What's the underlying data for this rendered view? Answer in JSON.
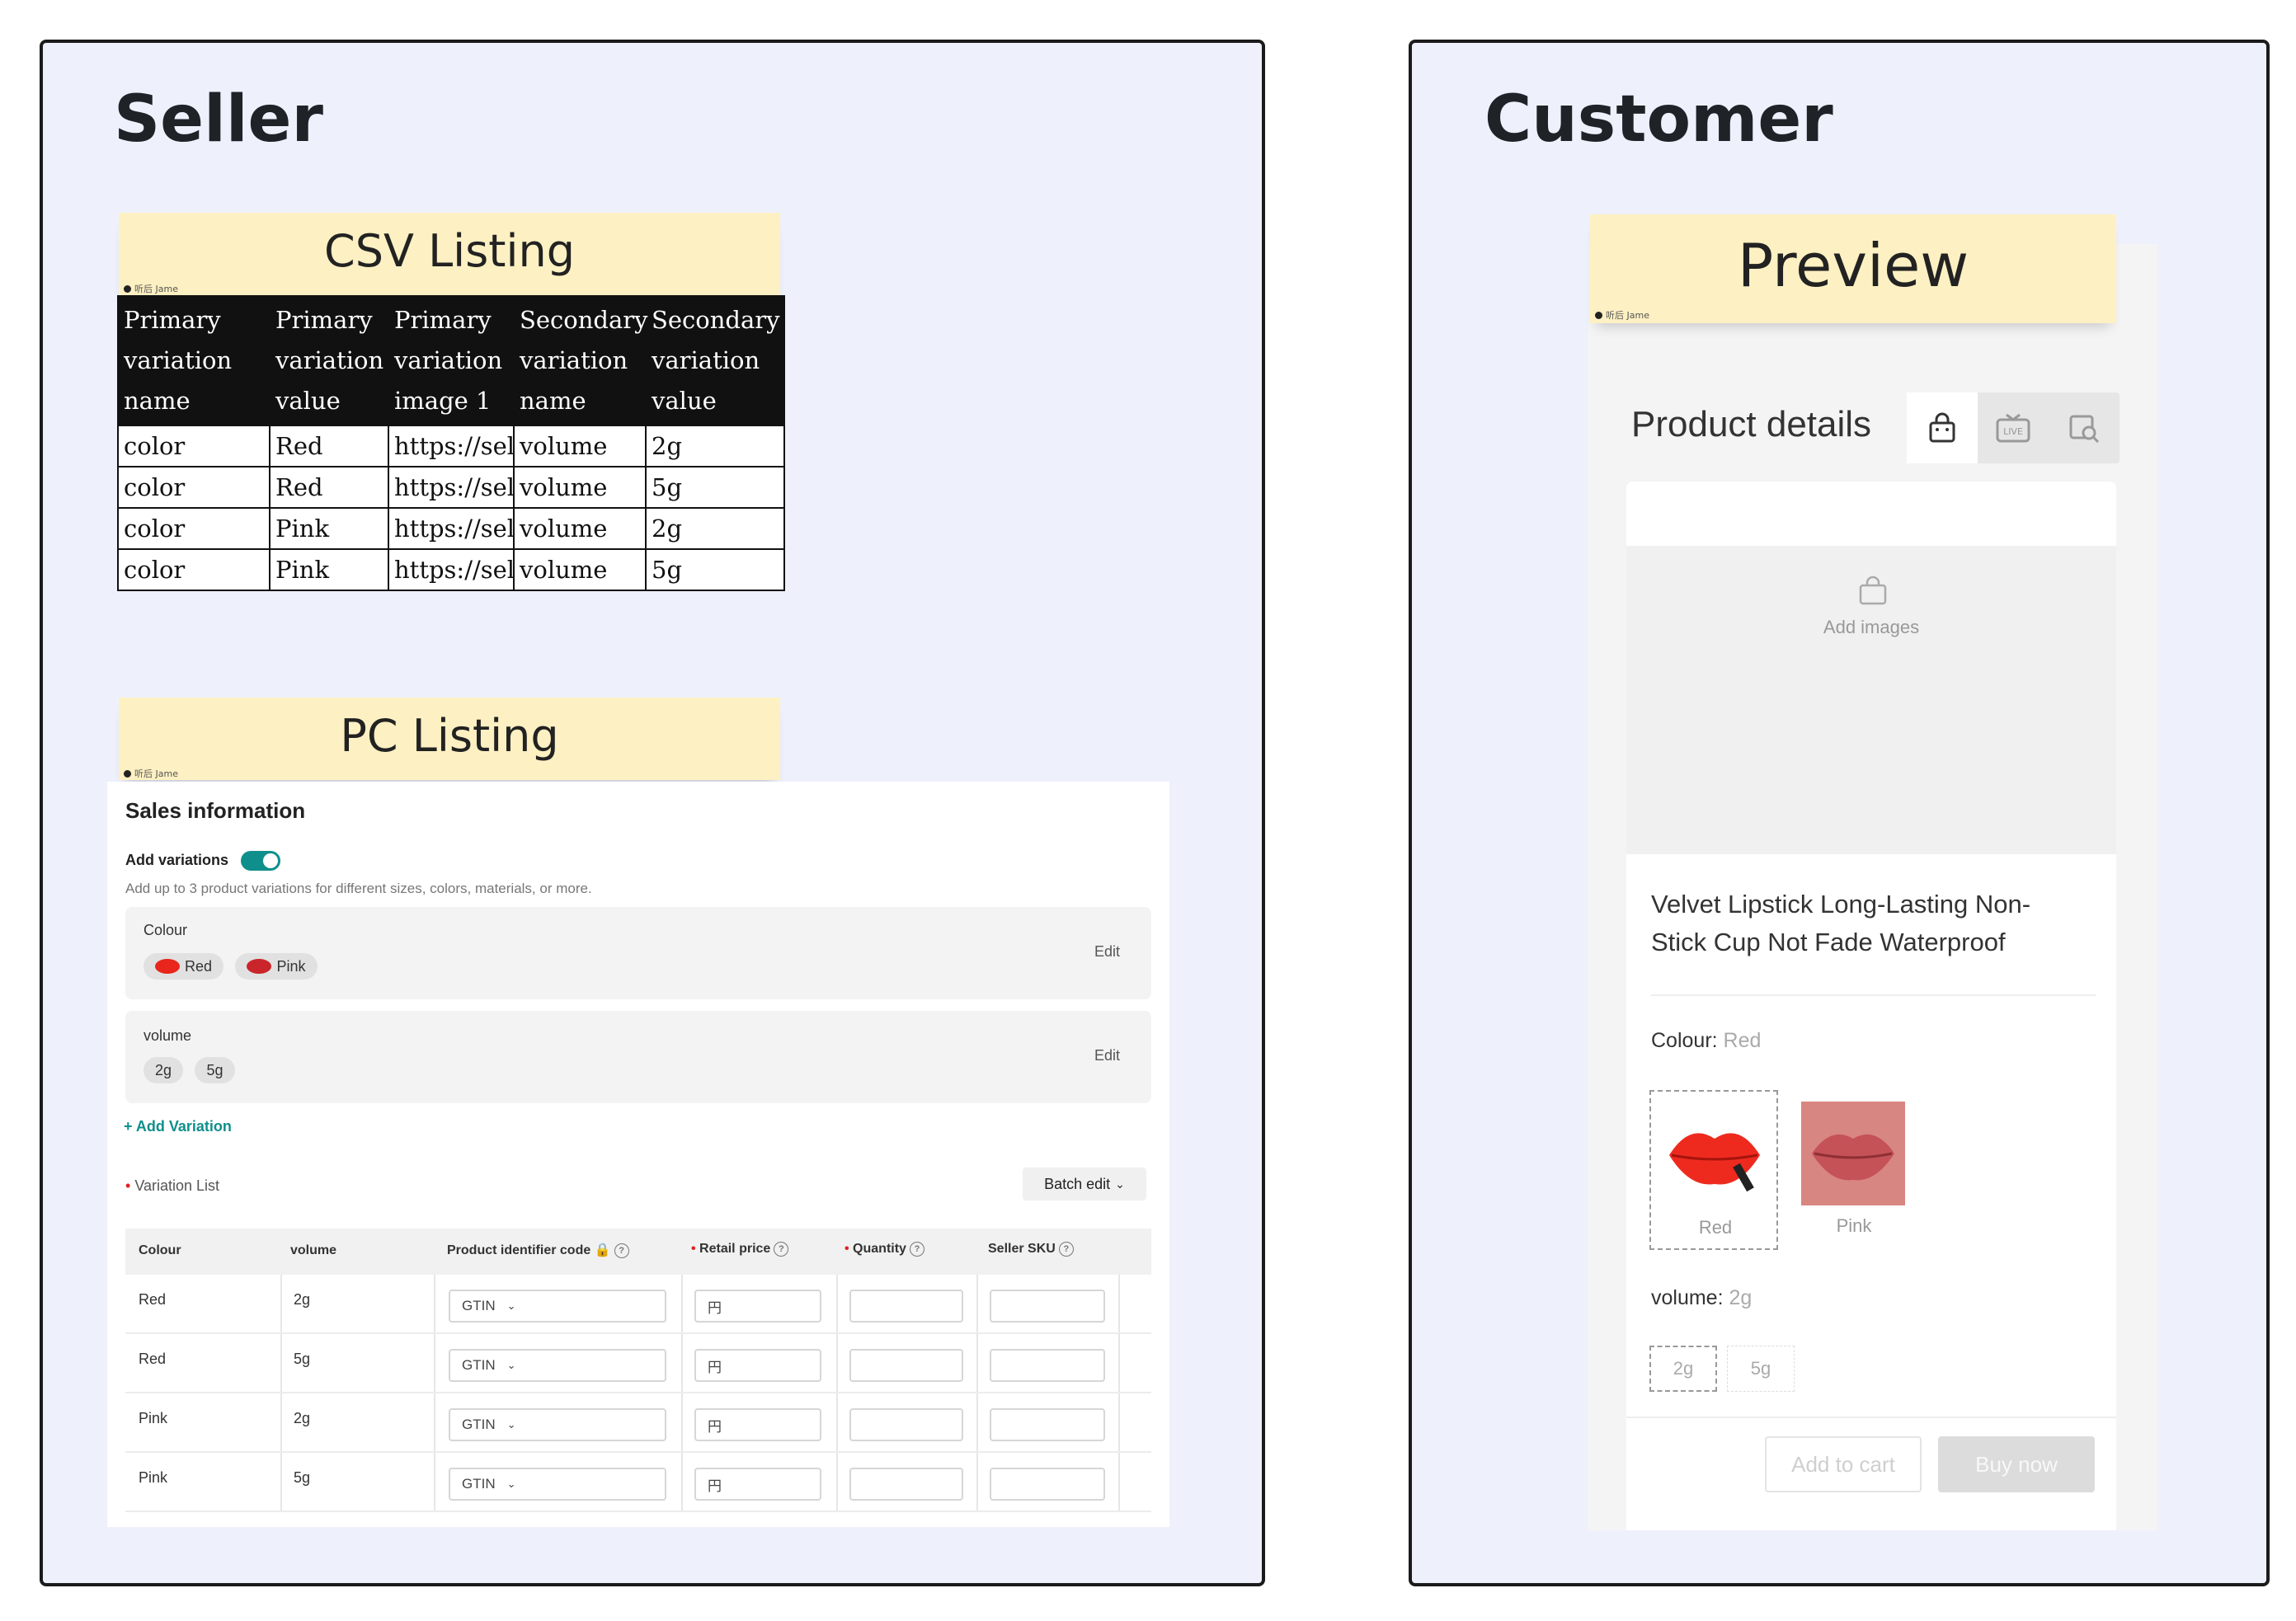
{
  "seller": {
    "title": "Seller",
    "csv": {
      "title": "CSV Listing",
      "stamp": "听后 Jame",
      "headers": [
        [
          "Primary",
          "variation",
          "name"
        ],
        [
          "Primary",
          "variation",
          "value"
        ],
        [
          "Primary",
          "variation",
          "image 1"
        ],
        [
          "Secondary",
          "variation",
          "name"
        ],
        [
          "Secondary",
          "variation",
          "value"
        ]
      ],
      "rows": [
        [
          "color",
          "Red",
          "https://sell",
          "volume",
          "2g"
        ],
        [
          "color",
          "Red",
          "https://sell",
          "volume",
          "5g"
        ],
        [
          "color",
          "Pink",
          "https://sell",
          "volume",
          "2g"
        ],
        [
          "color",
          "Pink",
          "https://sell",
          "volume",
          "5g"
        ]
      ]
    },
    "pc": {
      "title": "PC Listing",
      "stamp": "听后 Jame",
      "sales_info": "Sales information",
      "add_variations": "Add variations",
      "add_variations_hint": "Add up to 3 product variations for different sizes, colors, materials, or more.",
      "colour_group": {
        "label": "Colour",
        "chips": [
          "Red",
          "Pink"
        ],
        "edit": "Edit"
      },
      "volume_group": {
        "label": "volume",
        "chips": [
          "2g",
          "5g"
        ],
        "edit": "Edit"
      },
      "add_variation": "+ Add Variation",
      "variation_list": "Variation List",
      "batch_edit": "Batch edit",
      "table_headers": [
        "Colour",
        "volume",
        "Product identifier code",
        "Retail price",
        "Quantity",
        "Seller SKU"
      ],
      "rows": [
        {
          "colour": "Red",
          "volume": "2g",
          "code": "GTIN",
          "currency": "円"
        },
        {
          "colour": "Red",
          "volume": "5g",
          "code": "GTIN",
          "currency": "円"
        },
        {
          "colour": "Pink",
          "volume": "2g",
          "code": "GTIN",
          "currency": "円"
        },
        {
          "colour": "Pink",
          "volume": "5g",
          "code": "GTIN",
          "currency": "円"
        }
      ]
    }
  },
  "customer": {
    "title": "Customer",
    "preview": {
      "title": "Preview",
      "stamp": "听后 Jame",
      "product_details": "Product details",
      "add_images": "Add images",
      "product_title_line1": "Velvet Lipstick Long-Lasting Non-",
      "product_title_line2": "Stick Cup Not Fade Waterproof",
      "colour_label": "Colour:",
      "colour_value": "Red",
      "swatches": [
        "Red",
        "Pink"
      ],
      "volume_label": "volume:",
      "volume_value": "2g",
      "volume_options": [
        "2g",
        "5g"
      ],
      "add_to_cart": "Add to cart",
      "buy_now": "Buy now",
      "live_label": "LIVE"
    }
  },
  "colors": {
    "panel_bg": "#eef1fc",
    "sticky": "#fdf0c2",
    "toggle": "#0f8f8c",
    "lip_red": "#e8261c",
    "lip_pink": "#c9656a"
  }
}
